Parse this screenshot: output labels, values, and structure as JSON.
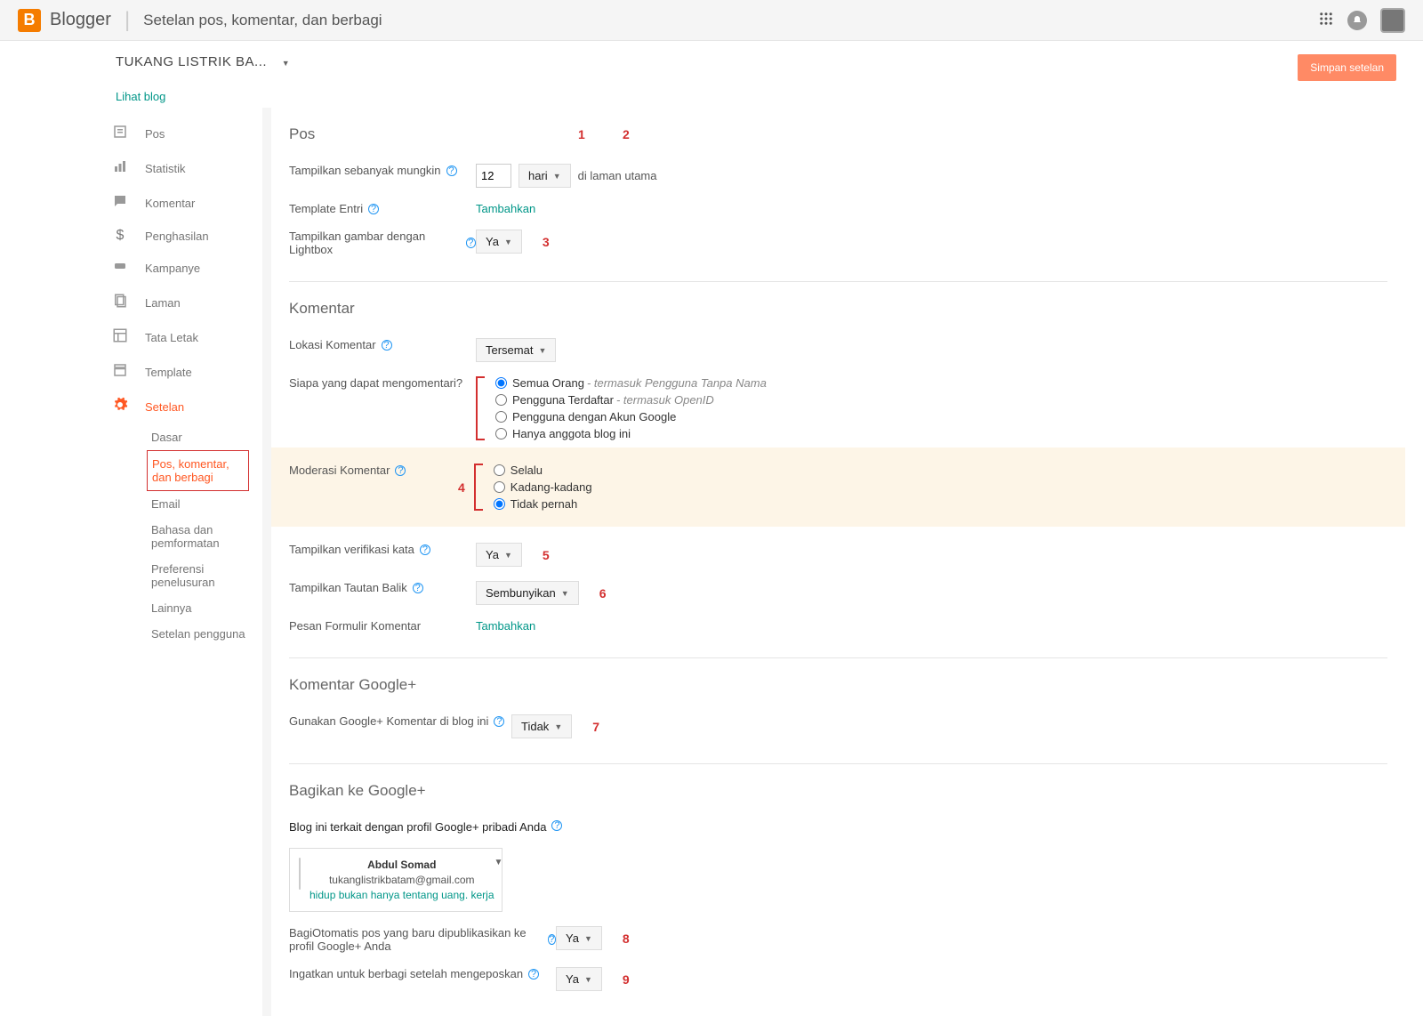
{
  "header": {
    "brand": "Blogger",
    "title": "Setelan pos, komentar, dan berbagi"
  },
  "blogSelect": {
    "name": "TUKANG LISTRIK BA...",
    "viewLink": "Lihat blog"
  },
  "saveBtn": "Simpan setelan",
  "nav": {
    "pos": "Pos",
    "stat": "Statistik",
    "komentar": "Komentar",
    "peng": "Penghasilan",
    "kamp": "Kampanye",
    "laman": "Laman",
    "tata": "Tata Letak",
    "templ": "Template",
    "setelan": "Setelan"
  },
  "subnav": {
    "dasar": "Dasar",
    "posKom": "Pos, komentar, dan berbagi",
    "email": "Email",
    "bahasa": "Bahasa dan pemformatan",
    "pref": "Preferensi penelusuran",
    "lain": "Lainnya",
    "setPeng": "Setelan pengguna"
  },
  "sections": {
    "pos": {
      "title": "Pos",
      "showMax": "Tampilkan sebanyak mungkin",
      "showMaxVal": "12",
      "showMaxUnit": "hari",
      "showMaxSuffix": "di laman utama",
      "entryTmpl": "Template Entri",
      "entryTmplAction": "Tambahkan",
      "lightbox": "Tampilkan gambar dengan Lightbox",
      "lightboxVal": "Ya"
    },
    "komentar": {
      "title": "Komentar",
      "lokasi": "Lokasi Komentar",
      "lokasiVal": "Tersemat",
      "siapa": "Siapa yang dapat mengomentari?",
      "radios": {
        "r1": "Semua Orang",
        "r1hint": "- termasuk Pengguna Tanpa Nama",
        "r2": "Pengguna Terdaftar",
        "r2hint": "- termasuk OpenID",
        "r3": "Pengguna dengan Akun Google",
        "r4": "Hanya anggota blog ini"
      },
      "moderasi": "Moderasi Komentar",
      "modRadios": {
        "m1": "Selalu",
        "m2": "Kadang-kadang",
        "m3": "Tidak pernah"
      },
      "verif": "Tampilkan verifikasi kata",
      "verifVal": "Ya",
      "balik": "Tampilkan Tautan Balik",
      "balikVal": "Sembunyikan",
      "pesan": "Pesan Formulir Komentar",
      "pesanAction": "Tambahkan"
    },
    "gplus": {
      "title": "Komentar Google+",
      "gunakan": "Gunakan Google+ Komentar di blog ini",
      "gunakanVal": "Tidak"
    },
    "bagikan": {
      "title": "Bagikan ke Google+",
      "desc": "Blog ini terkait dengan profil Google+ pribadi Anda",
      "profile": {
        "name": "Abdul Somad",
        "email": "tukanglistrikbatam@gmail.com",
        "tag": "hidup bukan hanya tentang uang. kerja"
      },
      "auto": "BagiOtomatis pos yang baru dipublikasikan ke profil Google+ Anda",
      "autoVal": "Ya",
      "remind": "Ingatkan untuk berbagi setelah mengeposkan",
      "remindVal": "Ya"
    }
  },
  "anno": {
    "a1": "1",
    "a2": "2",
    "a3": "3",
    "a4": "4",
    "a5": "5",
    "a6": "6",
    "a7": "7",
    "a8": "8",
    "a9": "9"
  }
}
